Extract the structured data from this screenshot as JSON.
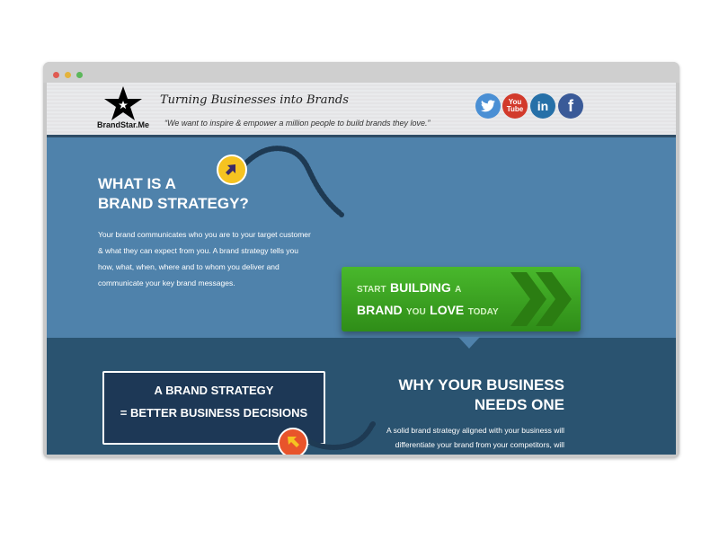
{
  "header": {
    "logo_text": "BrandStar.Me",
    "tagline": "Turning Businesses into Brands",
    "quote": "“We want to inspire & empower a million people to build brands they love.”",
    "social": [
      {
        "name": "twitter",
        "label": "t"
      },
      {
        "name": "youtube",
        "label": "You Tube"
      },
      {
        "name": "linkedin",
        "label": "in"
      },
      {
        "name": "facebook",
        "label": "f"
      }
    ]
  },
  "section1": {
    "heading_line1": "WHAT IS A",
    "heading_line2": "BRAND STRATEGY?",
    "body": "Your brand communicates who you are to your target customer & what they can expect from you. A brand strategy tells you how, what, when, where and to whom you deliver and communicate your key brand messages."
  },
  "cta": {
    "start": "START",
    "building": "BUILDING",
    "a": "A",
    "brand": "BRAND",
    "you": "YOU",
    "love": "LOVE",
    "today": "TODAY"
  },
  "section2": {
    "box_line1": "A BRAND STRATEGY",
    "box_line2": "= BETTER BUSINESS DECISIONS",
    "heading_line1": "WHY YOUR BUSINESS",
    "heading_line2": "NEEDS ONE",
    "body": "A solid brand strategy aligned with your business will differentiate your brand from your competitors, will illustrate who your customers need & want you to be & will"
  },
  "colors": {
    "section1_bg": "#4f82ab",
    "section2_bg": "#2a5370",
    "cta_green": "#3fa824",
    "badge_yellow": "#f5c321"
  }
}
